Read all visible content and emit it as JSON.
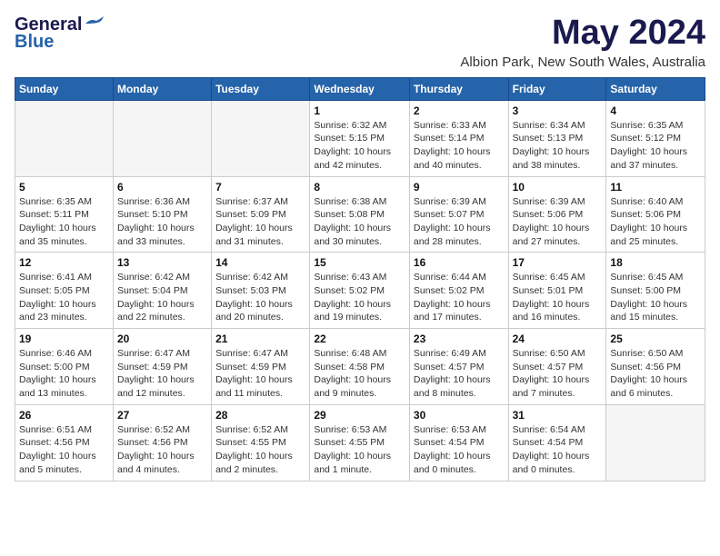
{
  "logo": {
    "general": "General",
    "blue": "Blue"
  },
  "title": "May 2024",
  "location": "Albion Park, New South Wales, Australia",
  "headers": [
    "Sunday",
    "Monday",
    "Tuesday",
    "Wednesday",
    "Thursday",
    "Friday",
    "Saturday"
  ],
  "weeks": [
    [
      {
        "day": "",
        "info": ""
      },
      {
        "day": "",
        "info": ""
      },
      {
        "day": "",
        "info": ""
      },
      {
        "day": "1",
        "info": "Sunrise: 6:32 AM\nSunset: 5:15 PM\nDaylight: 10 hours\nand 42 minutes."
      },
      {
        "day": "2",
        "info": "Sunrise: 6:33 AM\nSunset: 5:14 PM\nDaylight: 10 hours\nand 40 minutes."
      },
      {
        "day": "3",
        "info": "Sunrise: 6:34 AM\nSunset: 5:13 PM\nDaylight: 10 hours\nand 38 minutes."
      },
      {
        "day": "4",
        "info": "Sunrise: 6:35 AM\nSunset: 5:12 PM\nDaylight: 10 hours\nand 37 minutes."
      }
    ],
    [
      {
        "day": "5",
        "info": "Sunrise: 6:35 AM\nSunset: 5:11 PM\nDaylight: 10 hours\nand 35 minutes."
      },
      {
        "day": "6",
        "info": "Sunrise: 6:36 AM\nSunset: 5:10 PM\nDaylight: 10 hours\nand 33 minutes."
      },
      {
        "day": "7",
        "info": "Sunrise: 6:37 AM\nSunset: 5:09 PM\nDaylight: 10 hours\nand 31 minutes."
      },
      {
        "day": "8",
        "info": "Sunrise: 6:38 AM\nSunset: 5:08 PM\nDaylight: 10 hours\nand 30 minutes."
      },
      {
        "day": "9",
        "info": "Sunrise: 6:39 AM\nSunset: 5:07 PM\nDaylight: 10 hours\nand 28 minutes."
      },
      {
        "day": "10",
        "info": "Sunrise: 6:39 AM\nSunset: 5:06 PM\nDaylight: 10 hours\nand 27 minutes."
      },
      {
        "day": "11",
        "info": "Sunrise: 6:40 AM\nSunset: 5:06 PM\nDaylight: 10 hours\nand 25 minutes."
      }
    ],
    [
      {
        "day": "12",
        "info": "Sunrise: 6:41 AM\nSunset: 5:05 PM\nDaylight: 10 hours\nand 23 minutes."
      },
      {
        "day": "13",
        "info": "Sunrise: 6:42 AM\nSunset: 5:04 PM\nDaylight: 10 hours\nand 22 minutes."
      },
      {
        "day": "14",
        "info": "Sunrise: 6:42 AM\nSunset: 5:03 PM\nDaylight: 10 hours\nand 20 minutes."
      },
      {
        "day": "15",
        "info": "Sunrise: 6:43 AM\nSunset: 5:02 PM\nDaylight: 10 hours\nand 19 minutes."
      },
      {
        "day": "16",
        "info": "Sunrise: 6:44 AM\nSunset: 5:02 PM\nDaylight: 10 hours\nand 17 minutes."
      },
      {
        "day": "17",
        "info": "Sunrise: 6:45 AM\nSunset: 5:01 PM\nDaylight: 10 hours\nand 16 minutes."
      },
      {
        "day": "18",
        "info": "Sunrise: 6:45 AM\nSunset: 5:00 PM\nDaylight: 10 hours\nand 15 minutes."
      }
    ],
    [
      {
        "day": "19",
        "info": "Sunrise: 6:46 AM\nSunset: 5:00 PM\nDaylight: 10 hours\nand 13 minutes."
      },
      {
        "day": "20",
        "info": "Sunrise: 6:47 AM\nSunset: 4:59 PM\nDaylight: 10 hours\nand 12 minutes."
      },
      {
        "day": "21",
        "info": "Sunrise: 6:47 AM\nSunset: 4:59 PM\nDaylight: 10 hours\nand 11 minutes."
      },
      {
        "day": "22",
        "info": "Sunrise: 6:48 AM\nSunset: 4:58 PM\nDaylight: 10 hours\nand 9 minutes."
      },
      {
        "day": "23",
        "info": "Sunrise: 6:49 AM\nSunset: 4:57 PM\nDaylight: 10 hours\nand 8 minutes."
      },
      {
        "day": "24",
        "info": "Sunrise: 6:50 AM\nSunset: 4:57 PM\nDaylight: 10 hours\nand 7 minutes."
      },
      {
        "day": "25",
        "info": "Sunrise: 6:50 AM\nSunset: 4:56 PM\nDaylight: 10 hours\nand 6 minutes."
      }
    ],
    [
      {
        "day": "26",
        "info": "Sunrise: 6:51 AM\nSunset: 4:56 PM\nDaylight: 10 hours\nand 5 minutes."
      },
      {
        "day": "27",
        "info": "Sunrise: 6:52 AM\nSunset: 4:56 PM\nDaylight: 10 hours\nand 4 minutes."
      },
      {
        "day": "28",
        "info": "Sunrise: 6:52 AM\nSunset: 4:55 PM\nDaylight: 10 hours\nand 2 minutes."
      },
      {
        "day": "29",
        "info": "Sunrise: 6:53 AM\nSunset: 4:55 PM\nDaylight: 10 hours\nand 1 minute."
      },
      {
        "day": "30",
        "info": "Sunrise: 6:53 AM\nSunset: 4:54 PM\nDaylight: 10 hours\nand 0 minutes."
      },
      {
        "day": "31",
        "info": "Sunrise: 6:54 AM\nSunset: 4:54 PM\nDaylight: 10 hours\nand 0 minutes."
      },
      {
        "day": "",
        "info": ""
      }
    ]
  ]
}
